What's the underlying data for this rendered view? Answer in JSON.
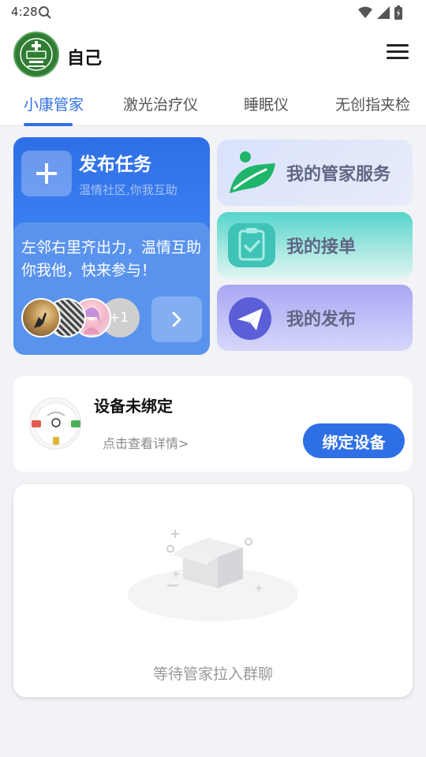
{
  "status_bar": {
    "time": "4:28",
    "icons": [
      "search-icon",
      "wifi-icon",
      "signal-icon",
      "battery-icon"
    ]
  },
  "header": {
    "title": "自己",
    "avatar_icon": "brand-logo"
  },
  "tabs": [
    {
      "label": "小康管家",
      "active": true
    },
    {
      "label": "激光治疗仪",
      "active": false
    },
    {
      "label": "睡眠仪",
      "active": false
    },
    {
      "label": "无创指夹检",
      "active": false
    }
  ],
  "publish": {
    "title": "发布任务",
    "subtitle": "温情社区,你我互助",
    "description": "左邻右里齐出力，温情互助你我他，快来参与！",
    "more_count": "+1"
  },
  "side_cards": [
    {
      "label": "我的管家服务",
      "icon": "leaf-icon"
    },
    {
      "label": "我的接单",
      "icon": "clipboard-check-icon"
    },
    {
      "label": "我的发布",
      "icon": "paper-plane-icon"
    }
  ],
  "device": {
    "title": "设备未绑定",
    "detail": "点击查看详情>",
    "bind_button": "绑定设备"
  },
  "group": {
    "empty_text": "等待管家拉入群聊"
  },
  "colors": {
    "accent": "#2f6fe6",
    "teal": "#4fd1c5",
    "purple": "#8f8cf0"
  }
}
